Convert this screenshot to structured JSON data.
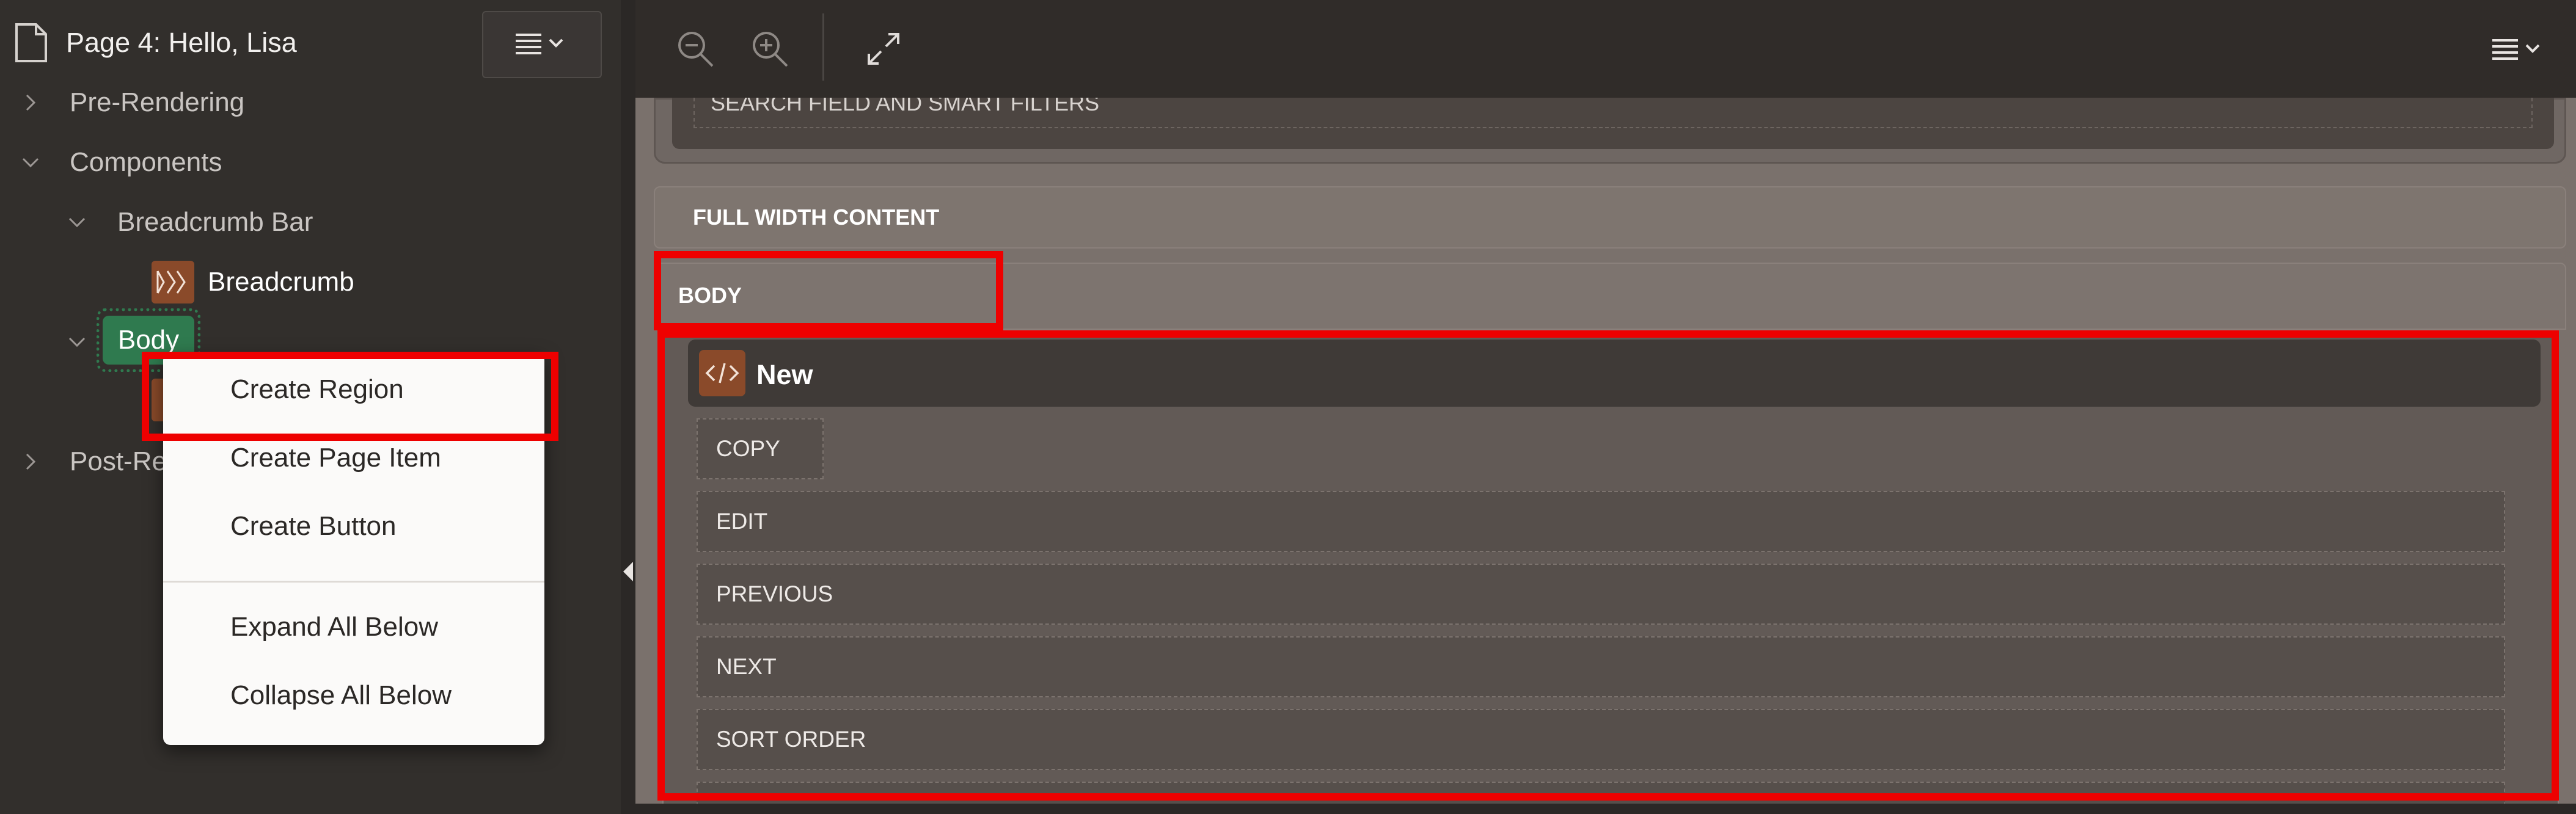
{
  "left_panel": {
    "page_title": "Page 4: Hello, Lisa",
    "tree": {
      "pre_rendering": "Pre-Rendering",
      "components": "Components",
      "breadcrumb_bar": "Breadcrumb Bar",
      "breadcrumb": "Breadcrumb",
      "body": "Body",
      "post_rendering_partial": "Post-Re"
    },
    "context_menu": {
      "items": [
        "Create Region",
        "Create Page Item",
        "Create Button",
        "Expand All Below",
        "Collapse All Below"
      ]
    }
  },
  "right_panel": {
    "search_region_label": "SEARCH FIELD AND SMART FILTERS",
    "full_width_content": "FULL WIDTH CONTENT",
    "body_label": "BODY",
    "new_region_label": "New",
    "slots": [
      "COPY",
      "EDIT",
      "PREVIOUS",
      "NEXT",
      "SORT ORDER"
    ]
  },
  "colors": {
    "highlight": "#ee0000",
    "body_node": "#2f7a4f",
    "region_icon": "#8a4a2a"
  },
  "icons": [
    "document-icon",
    "menu-icon",
    "chevron-right-icon",
    "chevron-down-icon",
    "breadcrumb-icon",
    "zoom-out-icon",
    "zoom-in-icon",
    "expand-icon",
    "code-icon",
    "collapse-panel-icon"
  ]
}
